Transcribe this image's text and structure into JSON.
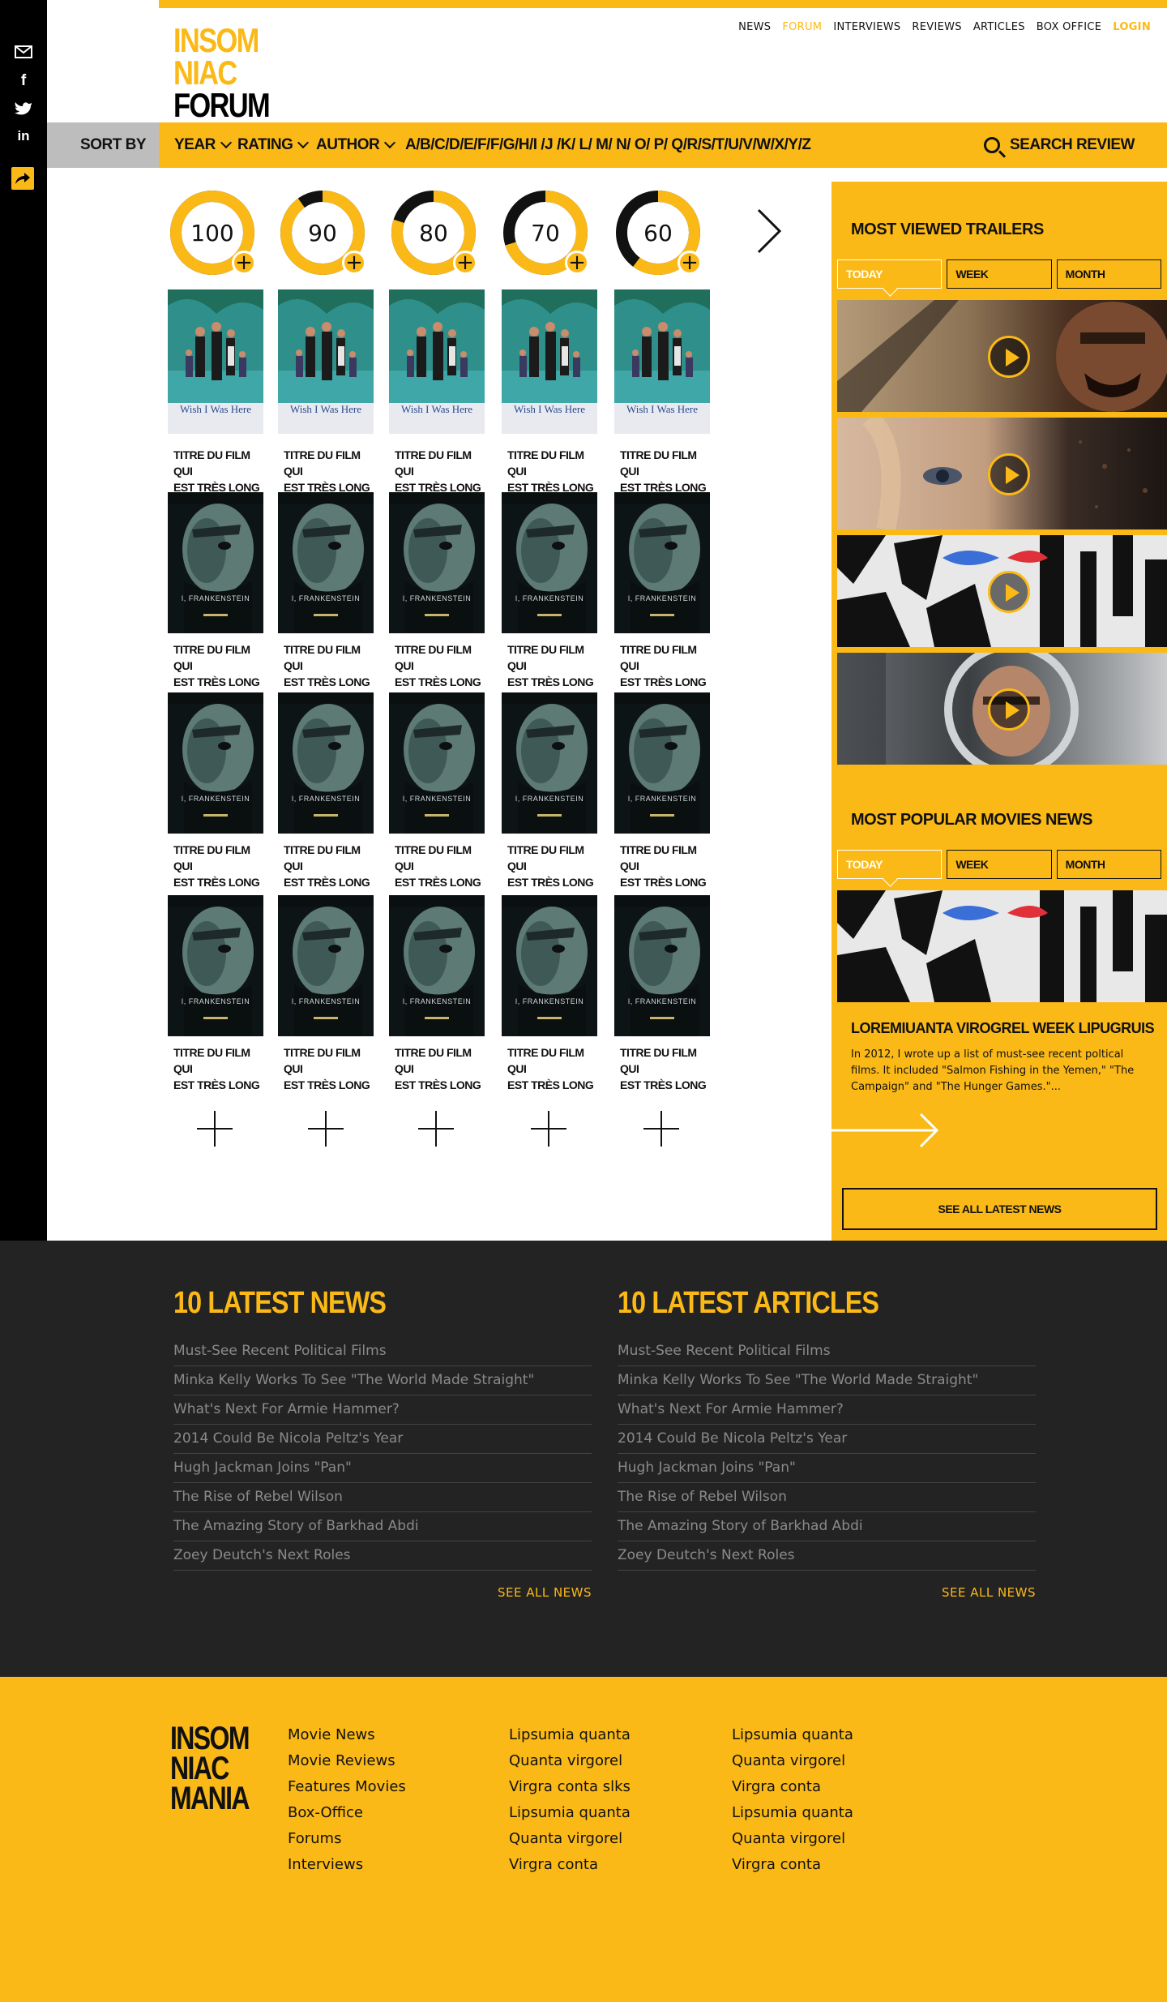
{
  "share": {
    "icons": [
      "mail-icon",
      "facebook-icon",
      "twitter-icon",
      "linkedin-icon",
      "share-icon"
    ],
    "labels": [
      "f",
      "in"
    ]
  },
  "logo": {
    "line1": "INSOM",
    "line2": "NIAC",
    "line3": "FORUM"
  },
  "nav": {
    "items": [
      "NEWS",
      "FORUM",
      "INTERVIEWS",
      "REVIEWS",
      "ARTICLES",
      "BOX OFFICE"
    ],
    "login": "LOGIN",
    "active": "FORUM"
  },
  "sortbar": {
    "sort_by": "SORT BY",
    "year": "YEAR",
    "rating": "RATING",
    "author": "AUTHOR",
    "alphabet": "A/B/C/D/E/F/F/G/H/I /J /K/ L/ M/ N/ O/ P/ Q/R/S/T/U/V/W/X/Y/Z",
    "search": "SEARCH REVIEW"
  },
  "ratings": [
    {
      "label": "100",
      "fraction": 1.0
    },
    {
      "label": "90",
      "fraction": 0.9
    },
    {
      "label": "80",
      "fraction": 0.8
    },
    {
      "label": "70",
      "fraction": 0.7
    },
    {
      "label": "60",
      "fraction": 0.6
    }
  ],
  "poster_titles": [
    "TITRE DU FILM QUI",
    "EST TRÈS LONG"
  ],
  "poster_rows": [
    {
      "kind": "wish",
      "caption": "Wish I Was Here"
    },
    {
      "kind": "frank",
      "caption": "I, FRANKENSTEIN"
    },
    {
      "kind": "frank",
      "caption": "I, FRANKENSTEIN"
    },
    {
      "kind": "frank",
      "caption": "I, FRANKENSTEIN"
    }
  ],
  "trailers": {
    "title": "MOST VIEWED TRAILERS",
    "tabs": [
      "TODAY",
      "WEEK",
      "MONTH"
    ]
  },
  "popular": {
    "title": "MOST POPULAR MOVIES NEWS",
    "tabs": [
      "TODAY",
      "WEEK",
      "MONTH"
    ],
    "headline": "LOREMIUANTA VIROGREL WEEK LIPUGRUIS",
    "excerpt": "In 2012, I wrote up a list of must-see recent poltical films. It included \"Salmon Fishing in the Yemen,\" \"The Campaign\" and \"The Hunger Games.\"...",
    "see_all": "SEE ALL LATEST NEWS"
  },
  "latest_news": {
    "title": "10 LATEST NEWS",
    "items": [
      "Must-See Recent Political Films",
      "Minka Kelly Works To See \"The World Made Straight\"",
      "What's Next For Armie Hammer?",
      "2014 Could Be Nicola Peltz's Year",
      "Hugh Jackman Joins \"Pan\"",
      "The Rise of Rebel Wilson",
      "The Amazing Story of Barkhad Abdi",
      "Zoey Deutch's Next Roles"
    ],
    "see_all": "SEE ALL NEWS"
  },
  "latest_articles": {
    "title": "10 LATEST ARTICLES",
    "items": [
      "Must-See Recent Political Films",
      "Minka Kelly Works To See \"The World Made Straight\"",
      "What's Next For Armie Hammer?",
      "2014 Could Be Nicola Peltz's Year",
      "Hugh Jackman Joins \"Pan\"",
      "The Rise of Rebel Wilson",
      "The Amazing Story of Barkhad Abdi",
      "Zoey Deutch's Next Roles"
    ],
    "see_all": "SEE ALL NEWS"
  },
  "footer": {
    "logo": {
      "line1": "INSOM",
      "line2": "NIAC",
      "line3": "MANIA"
    },
    "col1": [
      "Movie News",
      "Movie Reviews",
      "Features Movies",
      "Box-Office",
      "Forums",
      "Interviews"
    ],
    "col2": [
      "Lipsumia quanta",
      "Quanta virgorel",
      "Virgra conta slks",
      "Lipsumia quanta",
      "Quanta virgorel",
      "Virgra conta"
    ],
    "col3": [
      "Lipsumia quanta",
      "Quanta virgorel",
      "Virgra conta",
      "Lipsumia quanta",
      "Quanta virgorel",
      "Virgra conta"
    ]
  },
  "colors": {
    "accent": "#fbb917",
    "dark": "#232323",
    "black": "#000000"
  }
}
